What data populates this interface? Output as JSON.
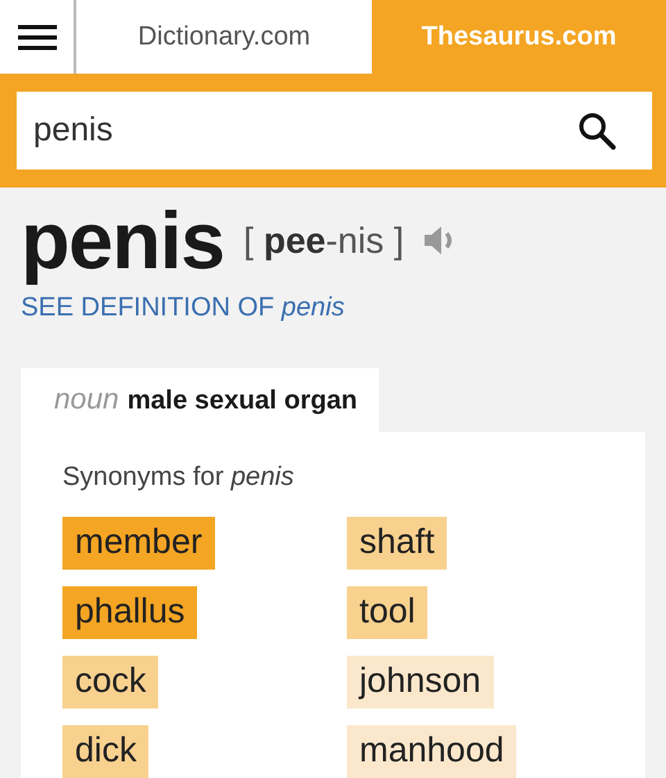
{
  "header": {
    "tabs": [
      {
        "label": "Dictionary.com",
        "selected": false
      },
      {
        "label": "Thesaurus.com",
        "selected": true
      }
    ]
  },
  "search": {
    "value": "penis"
  },
  "entry": {
    "word": "penis",
    "pronunciation": "[ **pee**-nis ]",
    "definition_link": "SEE DEFINITION OF *penis*"
  },
  "sense_tab": {
    "part_of_speech": "noun",
    "meaning": "male sexual organ"
  },
  "synonyms": {
    "heading": "Synonyms for *penis*",
    "items": [
      {
        "word": "member",
        "color": "#f4a523"
      },
      {
        "word": "shaft",
        "color": "#f8d18f"
      },
      {
        "word": "phallus",
        "color": "#f4a523"
      },
      {
        "word": "tool",
        "color": "#f8d18f"
      },
      {
        "word": "cock",
        "color": "#f8d18f"
      },
      {
        "word": "johnson",
        "color": "#fbe8cc"
      },
      {
        "word": "dick",
        "color": "#f8d18f"
      },
      {
        "word": "manhood",
        "color": "#fbe8cc"
      }
    ]
  }
}
